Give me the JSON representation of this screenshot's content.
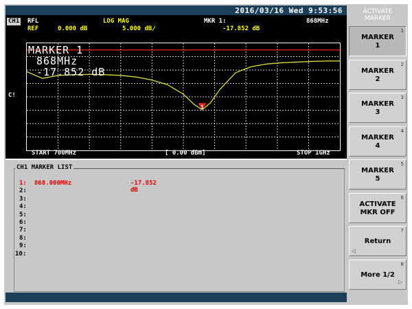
{
  "status": {
    "datetime": "2016/03/16 Wed   9:53:56"
  },
  "channel": {
    "tag": "CH1",
    "meas": "RFL",
    "format": "LOG MAG",
    "ref_label": "REF",
    "ref_value": "0.000 dB",
    "scale": "5.000 dB/",
    "mkr_label": "MKR  1:",
    "mkr_value": "-17.852 dB",
    "mkr_freq": "868MHz",
    "side_label": "C!",
    "start": "START 700MHz",
    "power": "[ 0.00 dBm]",
    "stop": "STOP 1GHz"
  },
  "plot_overlay": {
    "marker_title": "MARKER 1",
    "marker_freq": "868MHz",
    "marker_value": "-17.852 dB",
    "marker_badge": "1"
  },
  "chart_data": {
    "type": "line",
    "x": [
      700,
      715,
      730,
      745,
      760,
      775,
      790,
      805,
      820,
      835,
      850,
      860,
      868,
      876,
      885,
      900,
      915,
      930,
      945,
      960,
      975,
      990,
      1000
    ],
    "series": [
      {
        "values": [
          -6.5,
          -8.5,
          -7.6,
          -7.4,
          -7.3,
          -7.4,
          -7.6,
          -8.1,
          -9.0,
          -10.4,
          -13.2,
          -16.2,
          -17.852,
          -15.8,
          -11.8,
          -6.8,
          -5.0,
          -4.2,
          -3.8,
          -3.6,
          -3.4,
          -3.3,
          -3.3
        ]
      }
    ],
    "xlim": [
      700,
      1000
    ],
    "ylim": [
      -30,
      2
    ],
    "ref_level": 0,
    "marker": {
      "x": 868,
      "y": -17.852
    },
    "grid": true,
    "trace_color": "#dcdc3c",
    "ref_line_color": "#d02020"
  },
  "marker_list": {
    "title": "CH1 MARKER LIST",
    "rows": [
      {
        "index": "1:",
        "freq": "868.000MHz",
        "value": "-17.852 dB"
      },
      {
        "index": "2:",
        "freq": "",
        "value": ""
      },
      {
        "index": "3:",
        "freq": "",
        "value": ""
      },
      {
        "index": "4:",
        "freq": "",
        "value": ""
      },
      {
        "index": "5:",
        "freq": "",
        "value": ""
      },
      {
        "index": "6:",
        "freq": "",
        "value": ""
      },
      {
        "index": "7:",
        "freq": "",
        "value": ""
      },
      {
        "index": "8:",
        "freq": "",
        "value": ""
      },
      {
        "index": "9:",
        "freq": "",
        "value": ""
      },
      {
        "index": "10:",
        "freq": "",
        "value": ""
      }
    ]
  },
  "softkeys": {
    "title": "ACTIVATE\nMARKER",
    "keys": [
      {
        "label": "MARKER\n1",
        "num": "1"
      },
      {
        "label": "MARKER\n2",
        "num": "2"
      },
      {
        "label": "MARKER\n3",
        "num": "3"
      },
      {
        "label": "MARKER\n4",
        "num": "4"
      },
      {
        "label": "MARKER\n5",
        "num": "5"
      },
      {
        "label": "ACTIVATE\nMKR OFF",
        "num": "6"
      },
      {
        "label": "Return",
        "num": "7"
      },
      {
        "label": "More 1/2",
        "num": "8"
      }
    ]
  },
  "colors": {
    "header_bar": "#1c3f5a",
    "active_marker": "#e00000",
    "panel_bg": "#c8c8c8"
  }
}
